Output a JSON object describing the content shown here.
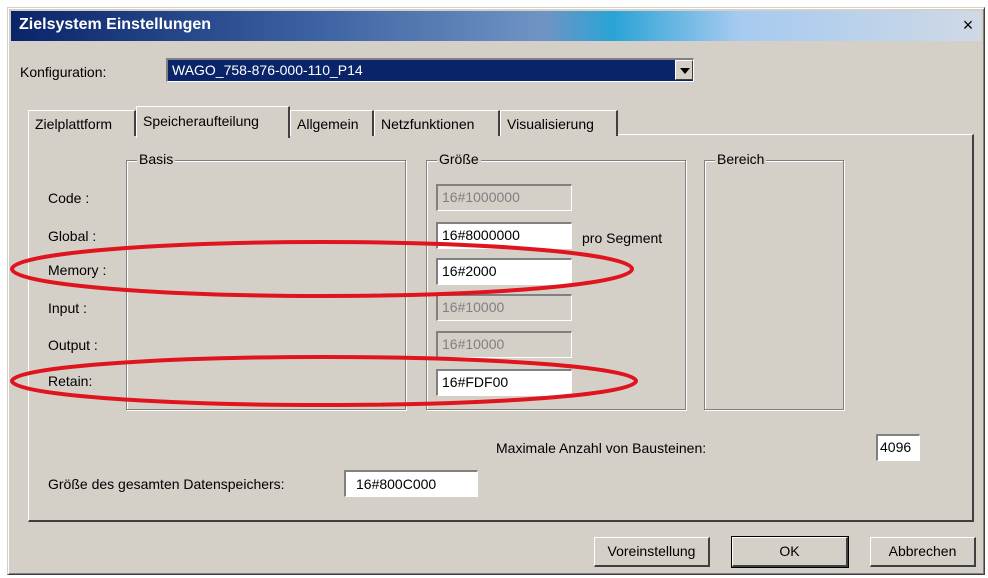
{
  "window": {
    "title": "Zielsystem Einstellungen",
    "close_glyph": "×"
  },
  "configuration": {
    "label": "Konfiguration:",
    "value": "WAGO_758-876-000-110_P14"
  },
  "tabs": [
    {
      "label": "Zielplattform",
      "active": false
    },
    {
      "label": "Speicheraufteilung",
      "active": true
    },
    {
      "label": "Allgemein",
      "active": false
    },
    {
      "label": "Netzfunktionen",
      "active": false
    },
    {
      "label": "Visualisierung",
      "active": false
    }
  ],
  "groups": {
    "basis": "Basis",
    "groesse": "Größe",
    "bereich": "Bereich"
  },
  "rows": [
    {
      "label": "Code :",
      "size": "16#1000000",
      "enabled": false
    },
    {
      "label": "Global :",
      "size": "16#8000000",
      "enabled": true,
      "suffix": "pro Segment"
    },
    {
      "label": "Memory :",
      "size": "16#2000",
      "enabled": true
    },
    {
      "label": "Input :",
      "size": "16#10000",
      "enabled": false
    },
    {
      "label": "Output :",
      "size": "16#10000",
      "enabled": false
    },
    {
      "label": "Retain:",
      "size": "16#FDF00",
      "enabled": true
    }
  ],
  "max_blocks": {
    "label": "Maximale Anzahl von Bausteinen:",
    "value": "4096"
  },
  "total_data": {
    "label": "Größe des gesamten Datenspeichers:",
    "value": "16#800C000"
  },
  "buttons": {
    "defaults": "Voreinstellung",
    "ok": "OK",
    "cancel": "Abbrechen"
  },
  "colors": {
    "annotation": "#e0141e",
    "titlebar_start": "#0a246a",
    "face": "#d4d0c8"
  }
}
